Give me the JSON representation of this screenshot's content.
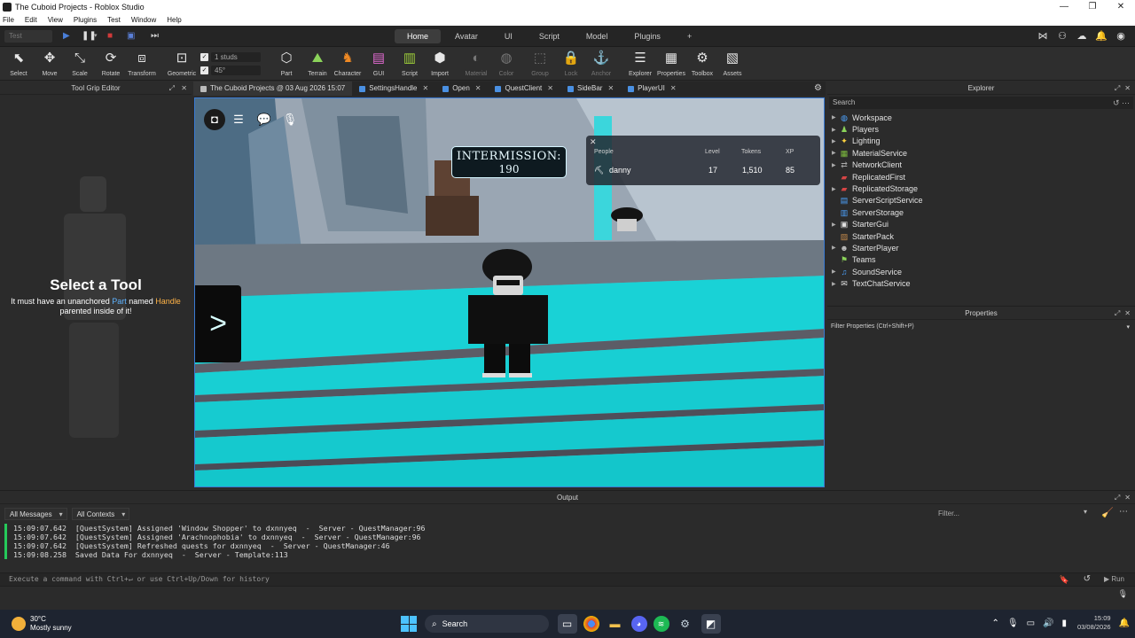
{
  "window": {
    "title": "The Cuboid Projects - Roblox Studio"
  },
  "menu": [
    "File",
    "Edit",
    "View",
    "Plugins",
    "Test",
    "Window",
    "Help"
  ],
  "quickbar": {
    "mode": "Test",
    "ribbon_tabs": [
      "Home",
      "Avatar",
      "UI",
      "Script",
      "Model",
      "Plugins"
    ],
    "active_tab": "Home",
    "add_tab": "+"
  },
  "ribbon": {
    "tools": [
      "Select",
      "Move",
      "Scale",
      "Rotate",
      "Transform",
      "Geometric"
    ],
    "studs_value": "1 studs",
    "angle_value": "45°",
    "insert": [
      "Part",
      "Terrain",
      "Character",
      "GUI",
      "Script",
      "Import"
    ],
    "appearance": [
      "Material",
      "Color",
      "Group",
      "Lock",
      "Anchor"
    ],
    "panels": [
      "Explorer",
      "Properties",
      "Toolbox",
      "Assets"
    ]
  },
  "left_panel": {
    "title": "Tool Grip Editor",
    "heading": "Select a Tool",
    "line1_pre": "It must have an unanchored ",
    "line1_part": "Part",
    "line1_mid": " named ",
    "line1_handle": "Handle",
    "line2": "parented inside of it!"
  },
  "doc_tabs": [
    {
      "label": "The Cuboid Projects @ 03 Aug 2026 15:07",
      "active": true
    },
    {
      "label": "SettingsHandle"
    },
    {
      "label": "Open"
    },
    {
      "label": "QuestClient"
    },
    {
      "label": "SideBar"
    },
    {
      "label": "PlayerUI"
    }
  ],
  "viewport": {
    "intermission_title": "INTERMISSION:",
    "intermission_value": "190",
    "leaderboard": {
      "headers": [
        "People",
        "Level",
        "Tokens",
        "XP"
      ],
      "row": {
        "name": "danny",
        "level": "17",
        "tokens": "1,510",
        "xp": "85"
      }
    },
    "side_button": ">"
  },
  "explorer": {
    "title": "Explorer",
    "search_placeholder": "Search",
    "items": [
      {
        "label": "Workspace",
        "icon": "globe-icon",
        "color": "#4da3ff",
        "expandable": true
      },
      {
        "label": "Players",
        "icon": "players-icon",
        "color": "#8bd35a",
        "expandable": true
      },
      {
        "label": "Lighting",
        "icon": "bulb-icon",
        "color": "#ffd23f",
        "expandable": true
      },
      {
        "label": "MaterialService",
        "icon": "material-icon",
        "color": "#7fbf3f",
        "expandable": true
      },
      {
        "label": "NetworkClient",
        "icon": "network-icon",
        "color": "#aaaaaa",
        "expandable": true
      },
      {
        "label": "ReplicatedFirst",
        "icon": "folder-icon",
        "color": "#d64545",
        "expandable": false
      },
      {
        "label": "ReplicatedStorage",
        "icon": "folder-icon",
        "color": "#d64545",
        "expandable": true
      },
      {
        "label": "ServerScriptService",
        "icon": "script-service-icon",
        "color": "#4da3ff",
        "expandable": false
      },
      {
        "label": "ServerStorage",
        "icon": "storage-icon",
        "color": "#4da3ff",
        "expandable": false
      },
      {
        "label": "StarterGui",
        "icon": "gui-icon",
        "color": "#e0e0e0",
        "expandable": true
      },
      {
        "label": "StarterPack",
        "icon": "pack-icon",
        "color": "#c58b4c",
        "expandable": false
      },
      {
        "label": "StarterPlayer",
        "icon": "player-icon",
        "color": "#c0c0c0",
        "expandable": true
      },
      {
        "label": "Teams",
        "icon": "teams-icon",
        "color": "#8bd35a",
        "expandable": false
      },
      {
        "label": "SoundService",
        "icon": "sound-icon",
        "color": "#4da3ff",
        "expandable": true
      },
      {
        "label": "TextChatService",
        "icon": "chat-icon",
        "color": "#e0e0e0",
        "expandable": true
      }
    ]
  },
  "properties": {
    "title": "Properties",
    "filter_placeholder": "Filter Properties (Ctrl+Shift+P)"
  },
  "output": {
    "title": "Output",
    "messages_filter": "All Messages",
    "contexts_filter": "All Contexts",
    "filter_placeholder": "Filter...",
    "lines": [
      "15:09:07.642  [QuestSystem] Assigned 'Window Shopper' to dxnnyeq  -  Server - QuestManager:96",
      "15:09:07.642  [QuestSystem] Assigned 'Arachnophobia' to dxnnyeq  -  Server - QuestManager:96",
      "15:09:07.642  [QuestSystem] Refreshed quests for dxnnyeq  -  Server - QuestManager:46",
      "15:09:08.258  Saved Data For dxnnyeq  -  Server - Template:113"
    ]
  },
  "command_bar": {
    "placeholder": "Execute a command with Ctrl+↵ or use Ctrl+Up/Down for history",
    "run_label": "Run"
  },
  "taskbar": {
    "temperature": "30°C",
    "weather": "Mostly sunny",
    "search_label": "Search",
    "time": "15:09",
    "date": "03/08/2026"
  }
}
